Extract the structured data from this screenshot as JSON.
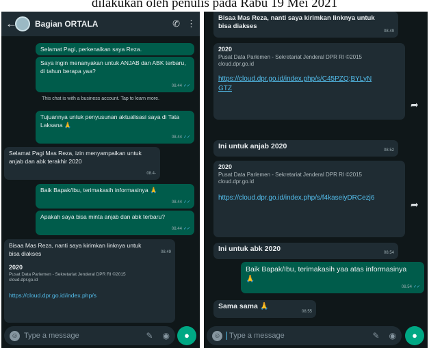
{
  "caption": "dilakukan oleh penulis pada Rabu 19 Mei 2021",
  "left": {
    "header": {
      "title": "Bagian ORTALA"
    },
    "messages": [
      {
        "text": "Selamat Pagi, perkenalkan saya Reza."
      },
      {
        "text": "Saya ingin menanyakan untuk ANJAB dan ABK terbaru, di tahun berapa yaa?",
        "time": "08.44"
      },
      {
        "text": "Tujuannya untuk penyusunan aktualisasi saya di Tata Laksana 🙏",
        "time": "08.44"
      },
      {
        "text": "Selamat Pagi Mas Reza, izin menyampaikan untuk anjab dan abk terakhir 2020",
        "time": "08.4-"
      },
      {
        "text": "Baik Bapak/Ibu, terimakasih informasinya 🙏",
        "time": "08.44"
      },
      {
        "text": "Apakah saya bisa minta anjab dan abk terbaru?",
        "time": "08.44"
      },
      {
        "text": "Bisaa Mas Reza, nanti saya kirimkan linknya untuk bisa diakses",
        "time": "08.49"
      }
    ],
    "system_notice": "This chat is with a business account. Tap to learn more.",
    "card": {
      "title": "2020",
      "desc": "Pusat Data Parlemen - Sekretariat Jenderal DPR RI ©2015",
      "domain": "cloud.dpr.go.id",
      "link": "https://cloud.dpr.go.id/index.php/s"
    },
    "composer_placeholder": "Type a message"
  },
  "right": {
    "messages": [
      {
        "text": "Bisaa Mas Reza, nanti saya kirimkan linknya untuk bisa diakses",
        "time": "08.49"
      },
      {
        "text": "Ini untuk anjab 2020",
        "time": "08.52"
      },
      {
        "text": "Ini untuk abk 2020",
        "time": "08.54"
      },
      {
        "text": "Baik Bapak/Ibu, terimakasih yaa atas informasinya 🙏",
        "time": "08.54"
      },
      {
        "text": "Sama sama 🙏",
        "time": "08.55"
      }
    ],
    "card1": {
      "title": "2020",
      "desc": "Pusat Data Parlemen - Sekretariat Jenderal DPR RI ©2015",
      "domain": "cloud.dpr.go.id",
      "link": "https://cloud.dpr.go.id/index.php/s/C45PZQ;BYLyNGTZ"
    },
    "card2": {
      "title": "2020",
      "desc": "Pusat Data Parlemen - Sekretariat Jenderal DPR RI ©2015",
      "domain": "cloud.dpr.go.id",
      "link": "https://cloud.dpr.go.id/index.php/s/f4kaseiyDRCezj6"
    },
    "composer_placeholder": "Type a message"
  },
  "colors": {
    "outgoing": "#005c4b",
    "incoming": "#1f2c33",
    "background": "#0f1719",
    "link": "#53bdeb",
    "accent": "#00a884"
  }
}
